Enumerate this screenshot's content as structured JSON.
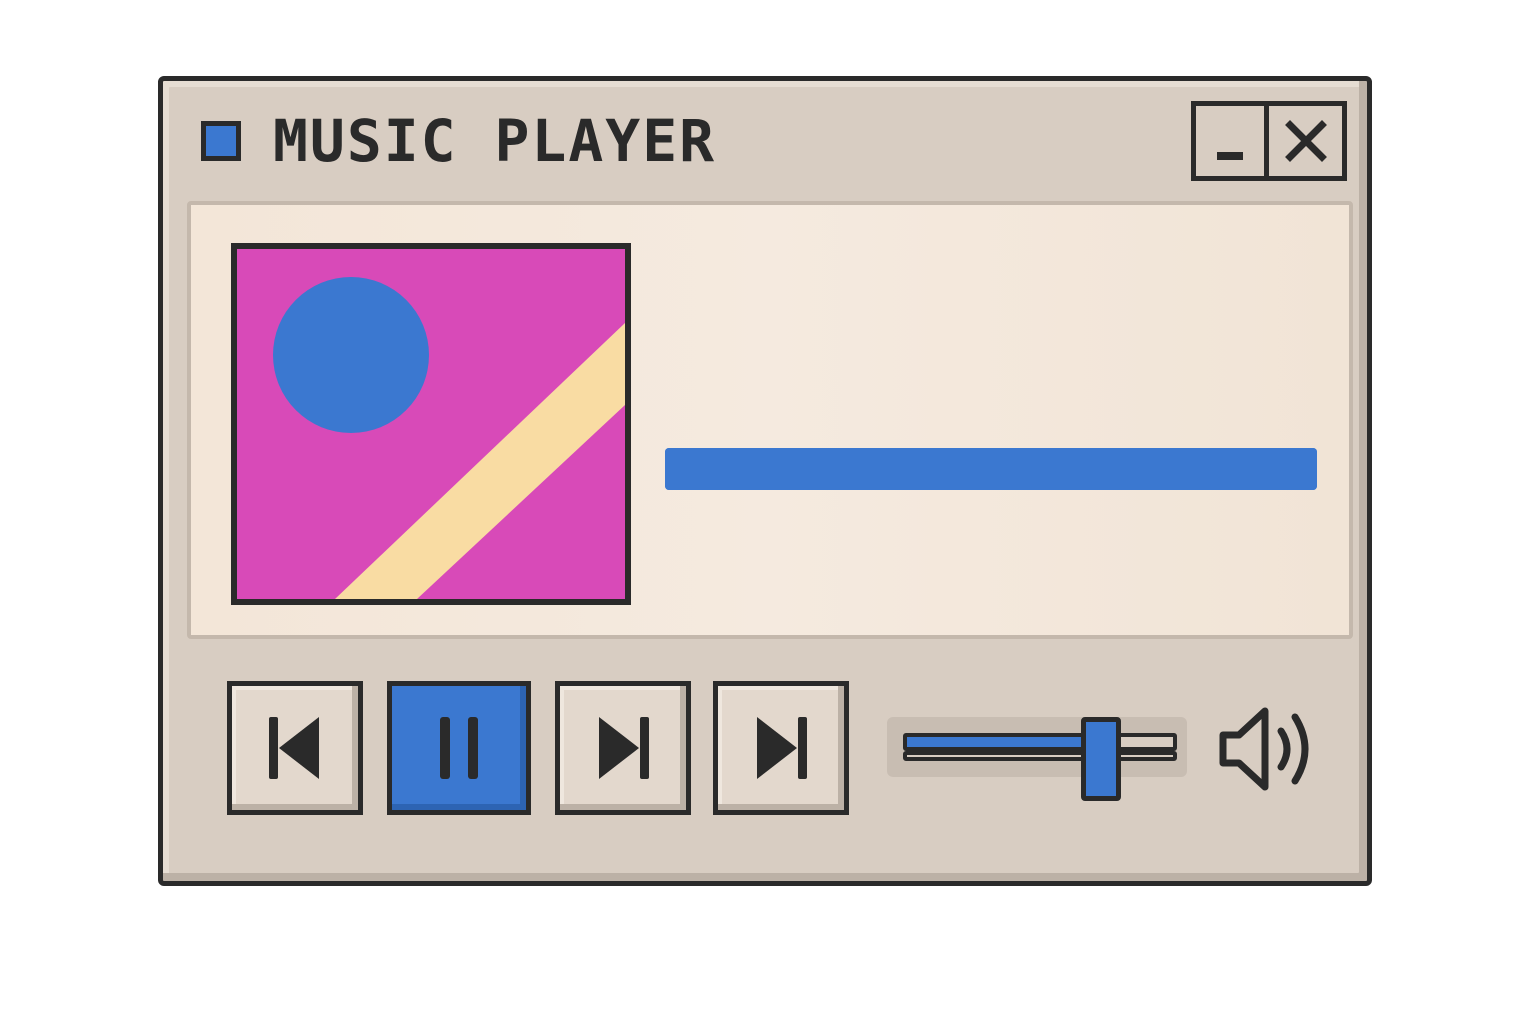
{
  "window": {
    "title": "MUSIC PLAYER"
  },
  "controls": {
    "minimize_icon": "minimize-icon",
    "close_icon": "close-icon",
    "buttons": [
      {
        "name": "previous",
        "icon": "skip-back-icon"
      },
      {
        "name": "pause",
        "icon": "pause-icon",
        "active": true
      },
      {
        "name": "next",
        "icon": "skip-forward-icon"
      },
      {
        "name": "skip",
        "icon": "skip-forward-icon"
      }
    ]
  },
  "playback": {
    "progress": 1.0
  },
  "volume": {
    "level": 0.72,
    "icon": "speaker-volume-icon"
  },
  "colors": {
    "accent": "#3b78d0",
    "album_background": "#d84ab8",
    "album_stripe": "#f9dca3",
    "window": "#d8cdc2",
    "border": "#2a2a2a"
  }
}
